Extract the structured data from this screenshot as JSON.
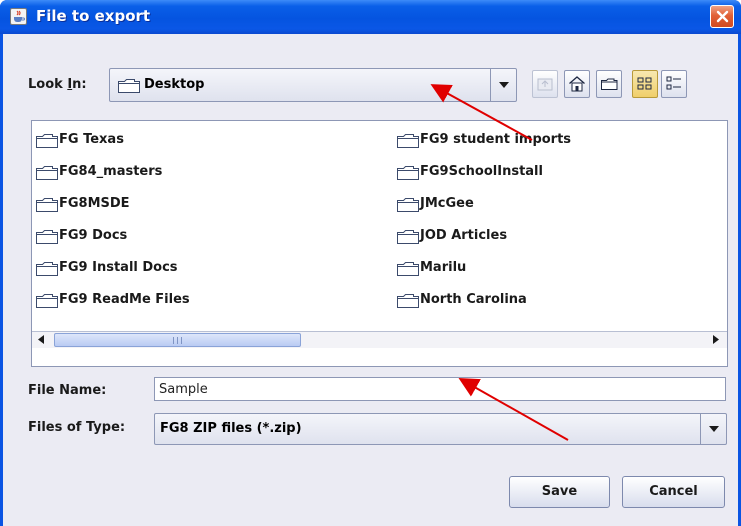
{
  "window": {
    "title": "File to export",
    "title_icon": "java-cup-icon",
    "close_icon": "close-icon"
  },
  "look_in": {
    "label": "Look In:",
    "label_mnemonic": "I",
    "value": "Desktop",
    "toolbar_icons": [
      "up-folder-icon",
      "home-icon",
      "new-folder-icon",
      "list-view-icon",
      "details-view-icon"
    ]
  },
  "files": {
    "left_column": [
      "FG Texas",
      "FG84_masters",
      "FG8MSDE",
      "FG9 Docs",
      "FG9 Install Docs",
      "FG9 ReadMe Files"
    ],
    "right_column": [
      "FG9 student imports",
      "FG9SchoolInstall",
      "JMcGee",
      "JOD Articles",
      "Marilu",
      "North Carolina"
    ]
  },
  "file_name": {
    "label": "File Name:",
    "value": "Sample"
  },
  "file_type": {
    "label": "Files of Type:",
    "value": "FG8 ZIP files (*.zip)"
  },
  "buttons": {
    "save": "Save",
    "cancel": "Cancel"
  },
  "colors": {
    "titlebar": "#0554e0",
    "dialog_bg": "#ebebf3",
    "annotation_arrow": "#e00000"
  }
}
